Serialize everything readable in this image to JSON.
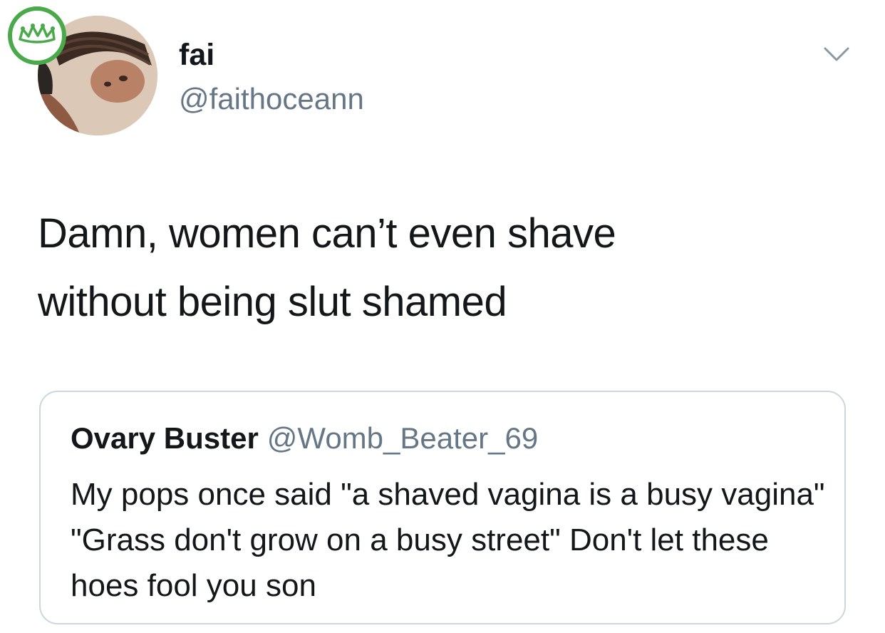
{
  "tweet": {
    "author": {
      "display_name": "fai",
      "handle": "@faithoceann"
    },
    "text_line1": "Damn, women can’t even shave",
    "text_line2": "without being slut shamed",
    "menu_icon": "chevron-down-icon"
  },
  "quoted_tweet": {
    "display_name": "Ovary Buster",
    "handle": "@Womb_Beater_69",
    "text": "My pops once said \"a shaved vagina is a busy vagina\" \"Grass don't grow on a busy street\" Don't let these hoes fool you son"
  },
  "badge": {
    "icon": "crown-icon",
    "color": "#4aa94a"
  },
  "colors": {
    "text_primary": "#14171a",
    "text_secondary": "#657786",
    "card_border": "#ccd6dd"
  }
}
